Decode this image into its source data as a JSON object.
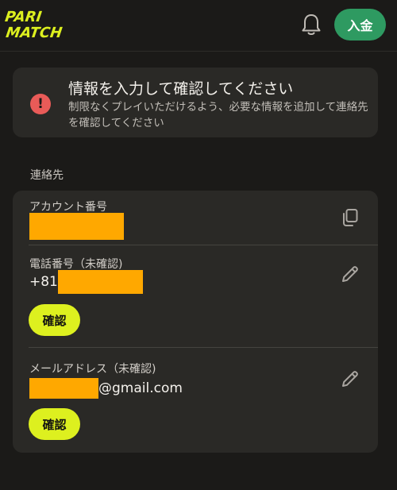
{
  "header": {
    "logo_text": "PARI MATCH",
    "deposit_label": "入金",
    "accent": "#2e9a61",
    "logo_color": "#ddf01f"
  },
  "alert": {
    "icon": "exclamation-icon",
    "title": "情報を入力して確認してください",
    "body": "制限なくプレイいただけるよう、必要な情報を追加して連絡先を確認してください"
  },
  "contact": {
    "section_label": "連絡先",
    "account": {
      "label": "アカウント番号",
      "action_icon": "copy-icon"
    },
    "phone": {
      "label": "電話番号（未確認)",
      "prefix": "+81",
      "action_icon": "pencil-icon",
      "confirm_label": "確認"
    },
    "email": {
      "label": "メールアドレス（未確認)",
      "suffix": "@gmail.com",
      "action_icon": "pencil-icon",
      "confirm_label": "確認"
    }
  }
}
